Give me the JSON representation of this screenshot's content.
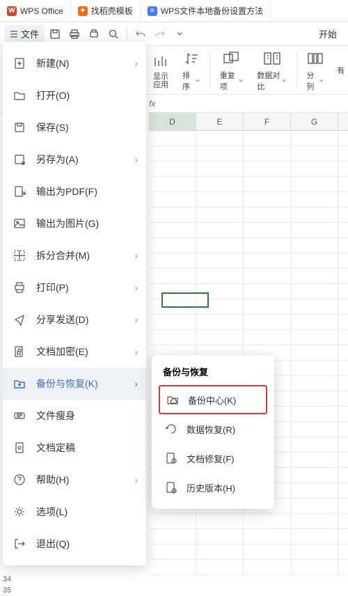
{
  "tabs": [
    {
      "icon": "W",
      "cls": "red",
      "label": "WPS Office"
    },
    {
      "icon": "✦",
      "cls": "orange",
      "label": "找稻壳模板"
    },
    {
      "icon": "≡",
      "cls": "blue",
      "label": "WPS文件本地备份设置方法"
    }
  ],
  "toolbar": {
    "file": "文件",
    "start": "开始"
  },
  "ribbon": {
    "r0a": "显示",
    "r0b": "应用",
    "r1": "排序",
    "r2": "重复项",
    "r3": "数据对比",
    "r4": "分列",
    "r5": "有"
  },
  "fx": "fx",
  "cols": [
    "D",
    "E",
    "F",
    "G"
  ],
  "menu": {
    "new": "新建(N)",
    "open": "打开(O)",
    "save": "保存(S)",
    "saveas": "另存为(A)",
    "pdf": "输出为PDF(F)",
    "img": "输出为图片(G)",
    "split": "拆分合并(M)",
    "print": "打印(P)",
    "share": "分享发送(D)",
    "encrypt": "文档加密(E)",
    "backup": "备份与恢复(K)",
    "slim": "文件瘦身",
    "pin": "文档定稿",
    "help": "帮助(H)",
    "options": "选项(L)",
    "exit": "退出(Q)"
  },
  "submenu": {
    "title": "备份与恢复",
    "center": "备份中心(K)",
    "recover": "数据恢复(R)",
    "repair": "文档修复(F)",
    "history": "历史版本(H)"
  },
  "rownums": {
    "a": "34",
    "b": "35"
  }
}
